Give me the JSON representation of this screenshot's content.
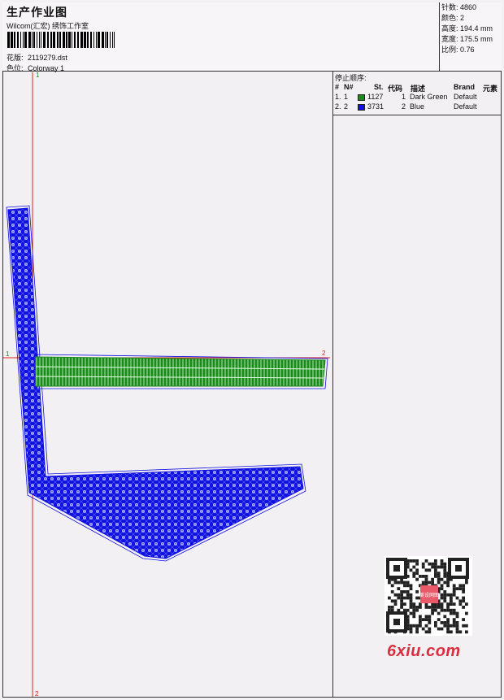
{
  "header": {
    "title": "生产作业图",
    "company": "Wilcom(汇宏) 绣饰工作室",
    "file_label": "花版:",
    "file_value": "2119279.dst",
    "color_label": "色位:",
    "color_value": "Colorway 1"
  },
  "stats": [
    {
      "label": "针数:",
      "value": "4860"
    },
    {
      "label": "颜色:",
      "value": "2"
    },
    {
      "label": "高度:",
      "value": "194.4 mm"
    },
    {
      "label": "宽度:",
      "value": "175.5 mm"
    },
    {
      "label": "比例:",
      "value": "0.76"
    }
  ],
  "stop_sequence": {
    "title": "停止顺序:",
    "columns": [
      "#",
      "N#",
      "St.",
      "代码",
      "描述",
      "Brand",
      "元素"
    ],
    "rows": [
      {
        "seq": "1.",
        "n": "1",
        "color": "#1a8a1a",
        "st": "1127",
        "code": "1",
        "desc": "Dark Green",
        "brand": "Default"
      },
      {
        "seq": "2.",
        "n": "2",
        "color": "#1010e0",
        "st": "3731",
        "code": "2",
        "desc": "Blue",
        "brand": "Default"
      }
    ]
  },
  "axis_marks": {
    "start": "1",
    "end": "2"
  },
  "watermark": {
    "site": "6xiu.com",
    "stamp": "美设网图"
  },
  "colors": {
    "green": "#1a8a1a",
    "blue": "#1010e0",
    "red_guide": "#e02020"
  }
}
